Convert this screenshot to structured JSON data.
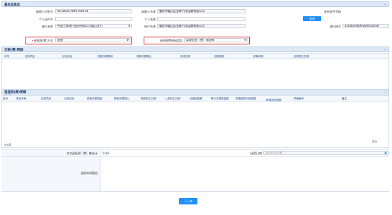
{
  "section_basic": {
    "title": "基本信息区"
  },
  "basic": {
    "taxpayer_id_label": "纳税人识别号",
    "taxpayer_id_value": "91500227699758974",
    "taxpayer_name_label": "纳税人名称",
    "taxpayer_name_value": "重庆市璧山区金辉汽车运输有限公司",
    "id_type_label": "身份证件号码",
    "personal_id_label": "个人证件号",
    "personal_name_label": "个人名称",
    "query_button": "查询",
    "bank_label": "银行名称",
    "bank_value": "中国工商银行股份有限公司璧山支行",
    "account_name_label": "账户名称",
    "account_name_value": "重庆市璧山区金辉汽车运输有限公司",
    "account_no_label": "银行账号",
    "account_no_value": "3100019009200035056",
    "refund_method_label": "退抵税(费)方式",
    "refund_method_value": "退税",
    "refund_type_label": "退抵税费原因类型",
    "refund_type_value": "误收征税（费）款退库"
  },
  "section_payment": {
    "title": "交税(费)明细",
    "columns": [
      "序号",
      "征收项目",
      "征收品目",
      "税款所属期起",
      "税款所属期止",
      "税(费)额",
      "税款属性",
      "税款种类",
      "征税发生日期"
    ],
    "footer": "共0条"
  },
  "section_refund": {
    "title": "退抵税(费)明细",
    "columns": [
      "序号",
      "原征号码",
      "征收项目",
      "征收品目",
      "税款所属期起",
      "税款所属期止",
      "税款发生日期",
      "入库发生日期",
      "已缴纳税额",
      "累计已退抵金额",
      "预退税费可退抵额",
      "申请退抵税额",
      "预退编号",
      "备注"
    ],
    "footer": "共0条",
    "total_label": "合计"
  },
  "summary": {
    "amount_label": "本次退抵税（费）额合计",
    "amount_value": "0.00",
    "date_label": "接受日期",
    "date_value": "2019-10-28",
    "reason_label": "退抵申请理由"
  },
  "next_button": "下一步",
  "colors": {
    "accent": "#1e90ff",
    "highlight": "#d9302e",
    "header_bg": "#dfe9f6"
  }
}
